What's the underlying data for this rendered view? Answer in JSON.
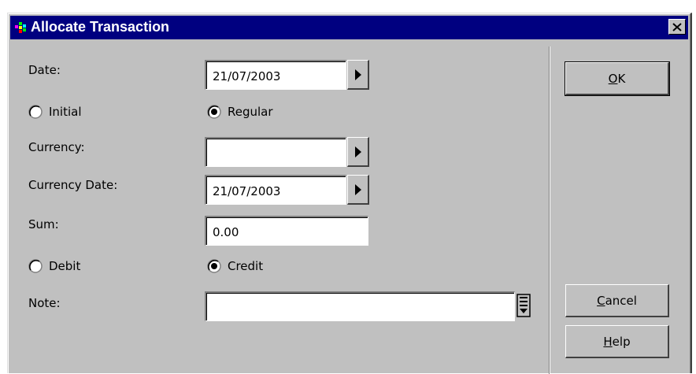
{
  "window": {
    "title": "Allocate Transaction"
  },
  "form": {
    "date_label": "Date:",
    "date_value": "21/07/2003",
    "initial_label": "Initial",
    "regular_label": "Regular",
    "currency_label": "Currency:",
    "currency_value": "",
    "currency_date_label": "Currency Date:",
    "currency_date_value": "21/07/2003",
    "sum_label": "Sum:",
    "sum_value": "0.00",
    "debit_label": "Debit",
    "credit_label": "Credit",
    "note_label": "Note:",
    "note_value": ""
  },
  "selection": {
    "initial_regular": "Regular",
    "debit_credit": "Credit"
  },
  "buttons": {
    "ok_accel": "O",
    "ok_rest": "K",
    "cancel_accel": "C",
    "cancel_rest": "ancel",
    "help_accel": "H",
    "help_rest": "elp"
  },
  "colors": {
    "titlebar": "#000080",
    "dialog_face": "#c0c0c0"
  },
  "icons": [
    "app-icon",
    "close-icon",
    "dropdown-arrow-icon",
    "note-editor-icon"
  ]
}
